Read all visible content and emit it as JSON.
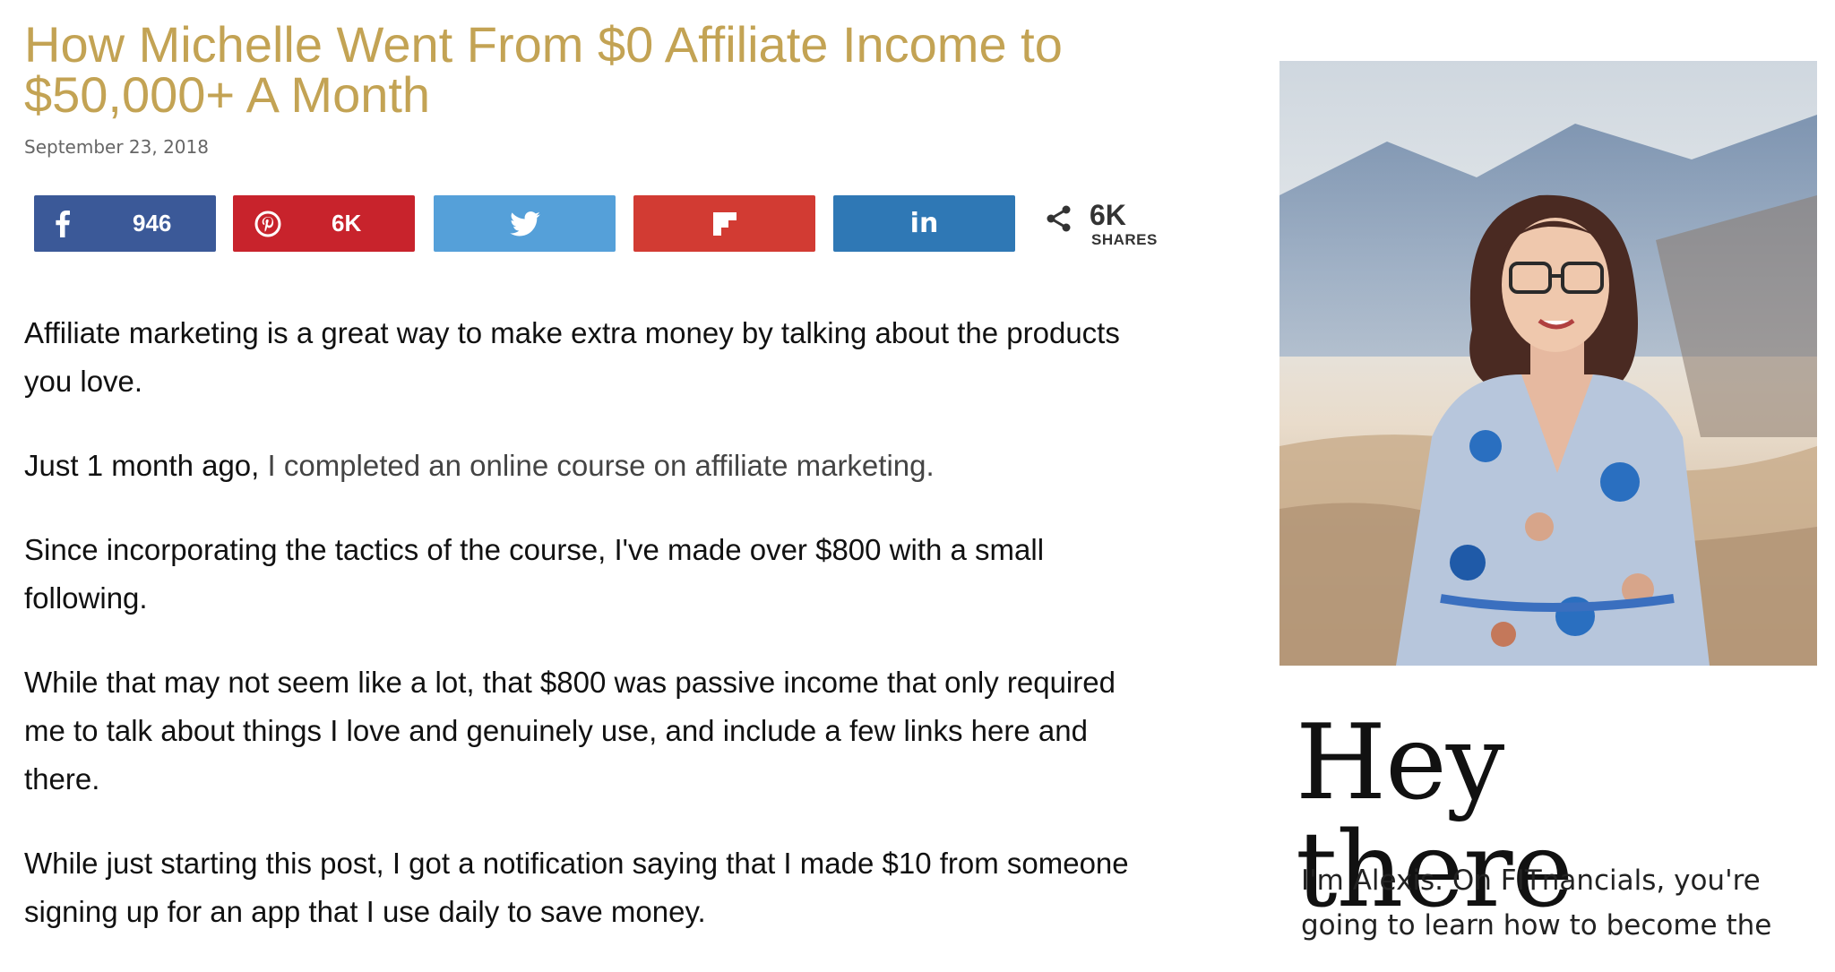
{
  "post": {
    "title": "How Michelle Went From $0 Affiliate Income to $50,000+ A Month",
    "date": "September 23, 2018"
  },
  "share": {
    "buttons": [
      {
        "network": "facebook",
        "icon": "facebook-icon",
        "count": "946",
        "color": "#3b5998"
      },
      {
        "network": "pinterest",
        "icon": "pinterest-icon",
        "count": "6K",
        "color": "#c8232c"
      },
      {
        "network": "twitter",
        "icon": "twitter-icon",
        "count": "",
        "color": "#55a0d9"
      },
      {
        "network": "flipboard",
        "icon": "flipboard-icon",
        "count": "",
        "color": "#d23b33"
      },
      {
        "network": "linkedin",
        "icon": "linkedin-icon",
        "count": "",
        "color": "#2f78b5"
      }
    ],
    "total_count": "6K",
    "total_label": "SHARES"
  },
  "body": {
    "p1": "Affiliate marketing is a great way to make extra money by talking about the products you love.",
    "p2_prefix": "Just 1 month ago, ",
    "p2_link": "I completed an online course on affiliate marketing.",
    "p3": "Since incorporating the tactics of the course, I've made over $800 with a small following.",
    "p4": "While that may not seem like a lot, that $800 was passive income that only required me to talk about things I love and genuinely use, and include a few links here and there.",
    "p5": "While just starting this post, I got a notification saying that I made $10 from someone signing up for an app that I use daily to save money."
  },
  "sidebar": {
    "heading": "Hey there",
    "intro": "I'm Alexis. On FITnancials, you're going to learn how to become the"
  }
}
